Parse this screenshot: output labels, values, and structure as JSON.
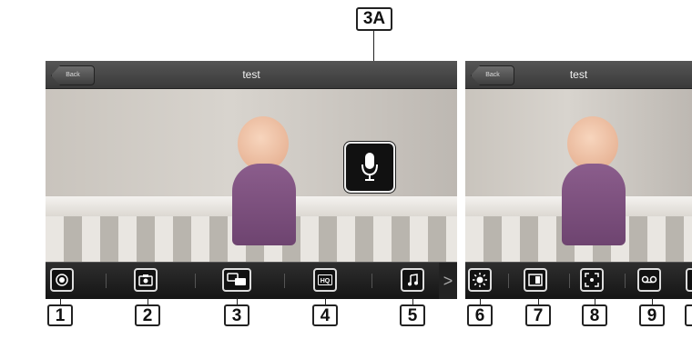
{
  "left_screen": {
    "back_label": "Back",
    "title": "test",
    "toolbar_icons": [
      "record-icon",
      "camera-icon",
      "talk-icon",
      "hq-icon",
      "music-icon"
    ],
    "next_arrow": ">"
  },
  "right_screen": {
    "back_label": "Back",
    "title": "test",
    "toolbar_icons": [
      "brightness-icon",
      "display-icon",
      "zoom-icon",
      "voicemail-icon"
    ]
  },
  "mic_button": {
    "icon": "microphone-icon"
  },
  "callouts": {
    "c1": "1",
    "c2": "2",
    "c3": "3",
    "c4": "4",
    "c5": "5",
    "c6": "6",
    "c7": "7",
    "c8": "8",
    "c9": "9",
    "c3a": "3A"
  }
}
